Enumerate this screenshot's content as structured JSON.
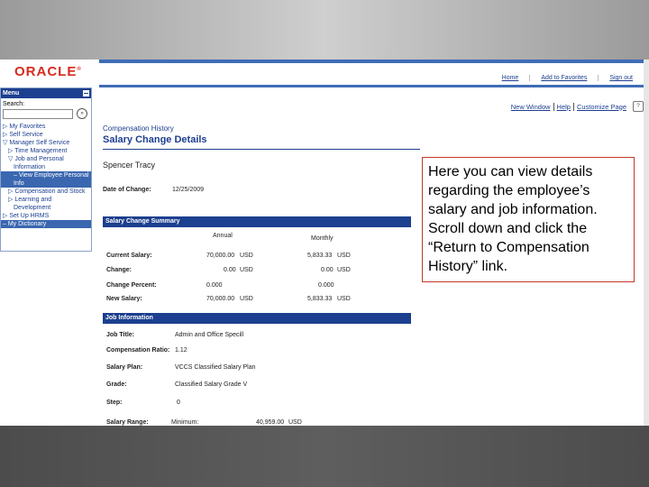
{
  "header": {
    "logo_text": "ORACLE",
    "top_links": [
      "Home",
      "Add to Favorites",
      "Sign out"
    ]
  },
  "menu": {
    "title": "Menu",
    "search_label": "Search:",
    "search_value": "",
    "go_icon": "»",
    "items": [
      {
        "label": "▷ My Favorites",
        "level": 1
      },
      {
        "label": "▷ Self Service",
        "level": 1
      },
      {
        "label": "▽ Manager Self Service",
        "level": 1
      },
      {
        "label": "▷ Time Management",
        "level": 2
      },
      {
        "label": "▽ Job and Personal",
        "level": 2
      },
      {
        "label": "Information",
        "level": 3
      },
      {
        "label": "– View Employee Personal",
        "level": 3,
        "selected": true
      },
      {
        "label": "Info",
        "level": 3,
        "selected": true
      },
      {
        "label": "▷ Compensation and Stock",
        "level": 2
      },
      {
        "label": "▷ Learning and",
        "level": 2
      },
      {
        "label": "Development",
        "level": 3
      },
      {
        "label": "▷ Set Up HRMS",
        "level": 1
      },
      {
        "label": "– My Dictionary",
        "level": 1,
        "selected": true
      }
    ]
  },
  "page_links": [
    "New Window",
    "Help",
    "Customize Page"
  ],
  "content": {
    "breadcrumb": "Compensation History",
    "title": "Salary Change Details",
    "employee_name": "Spencer Tracy",
    "date_of_change_label": "Date of Change:",
    "date_of_change_value": "12/25/2009"
  },
  "salary_summary": {
    "header": "Salary Change Summary",
    "col_annual": "Annual",
    "col_monthly": "Monthly",
    "rows": [
      {
        "label": "Current Salary:",
        "annual": "70,000.00",
        "annual_cur": "USD",
        "monthly": "5,833.33",
        "monthly_cur": "USD"
      },
      {
        "label": "Change:",
        "annual": "0.00",
        "annual_cur": "USD",
        "monthly": "0.00",
        "monthly_cur": "USD"
      },
      {
        "label": "Change Percent:",
        "annual": "0.000",
        "annual_cur": "",
        "monthly": "0.000",
        "monthly_cur": ""
      },
      {
        "label": "New Salary:",
        "annual": "70,000.00",
        "annual_cur": "USD",
        "monthly": "5,833.33",
        "monthly_cur": "USD"
      }
    ]
  },
  "job_info": {
    "header": "Job Information",
    "rows": [
      {
        "label": "Job Title:",
        "value": "Admin and Office Specill"
      },
      {
        "label": "Compensation Ratio:",
        "value": "1.12"
      },
      {
        "label": "Salary Plan:",
        "value": "VCCS Classified Salary Plan"
      },
      {
        "label": "Grade:",
        "value": "Classified Salary Grade V"
      },
      {
        "label": "Step:",
        "value": "0"
      }
    ],
    "range_label": "Salary Range:",
    "range_min_label": "Minimum:",
    "range_min_value": "40,959.00",
    "range_min_cur": "USD"
  },
  "callout": {
    "text": "Here you can view details regarding the employee’s salary and job information. Scroll down and click the “Return to Compensation History” link."
  }
}
